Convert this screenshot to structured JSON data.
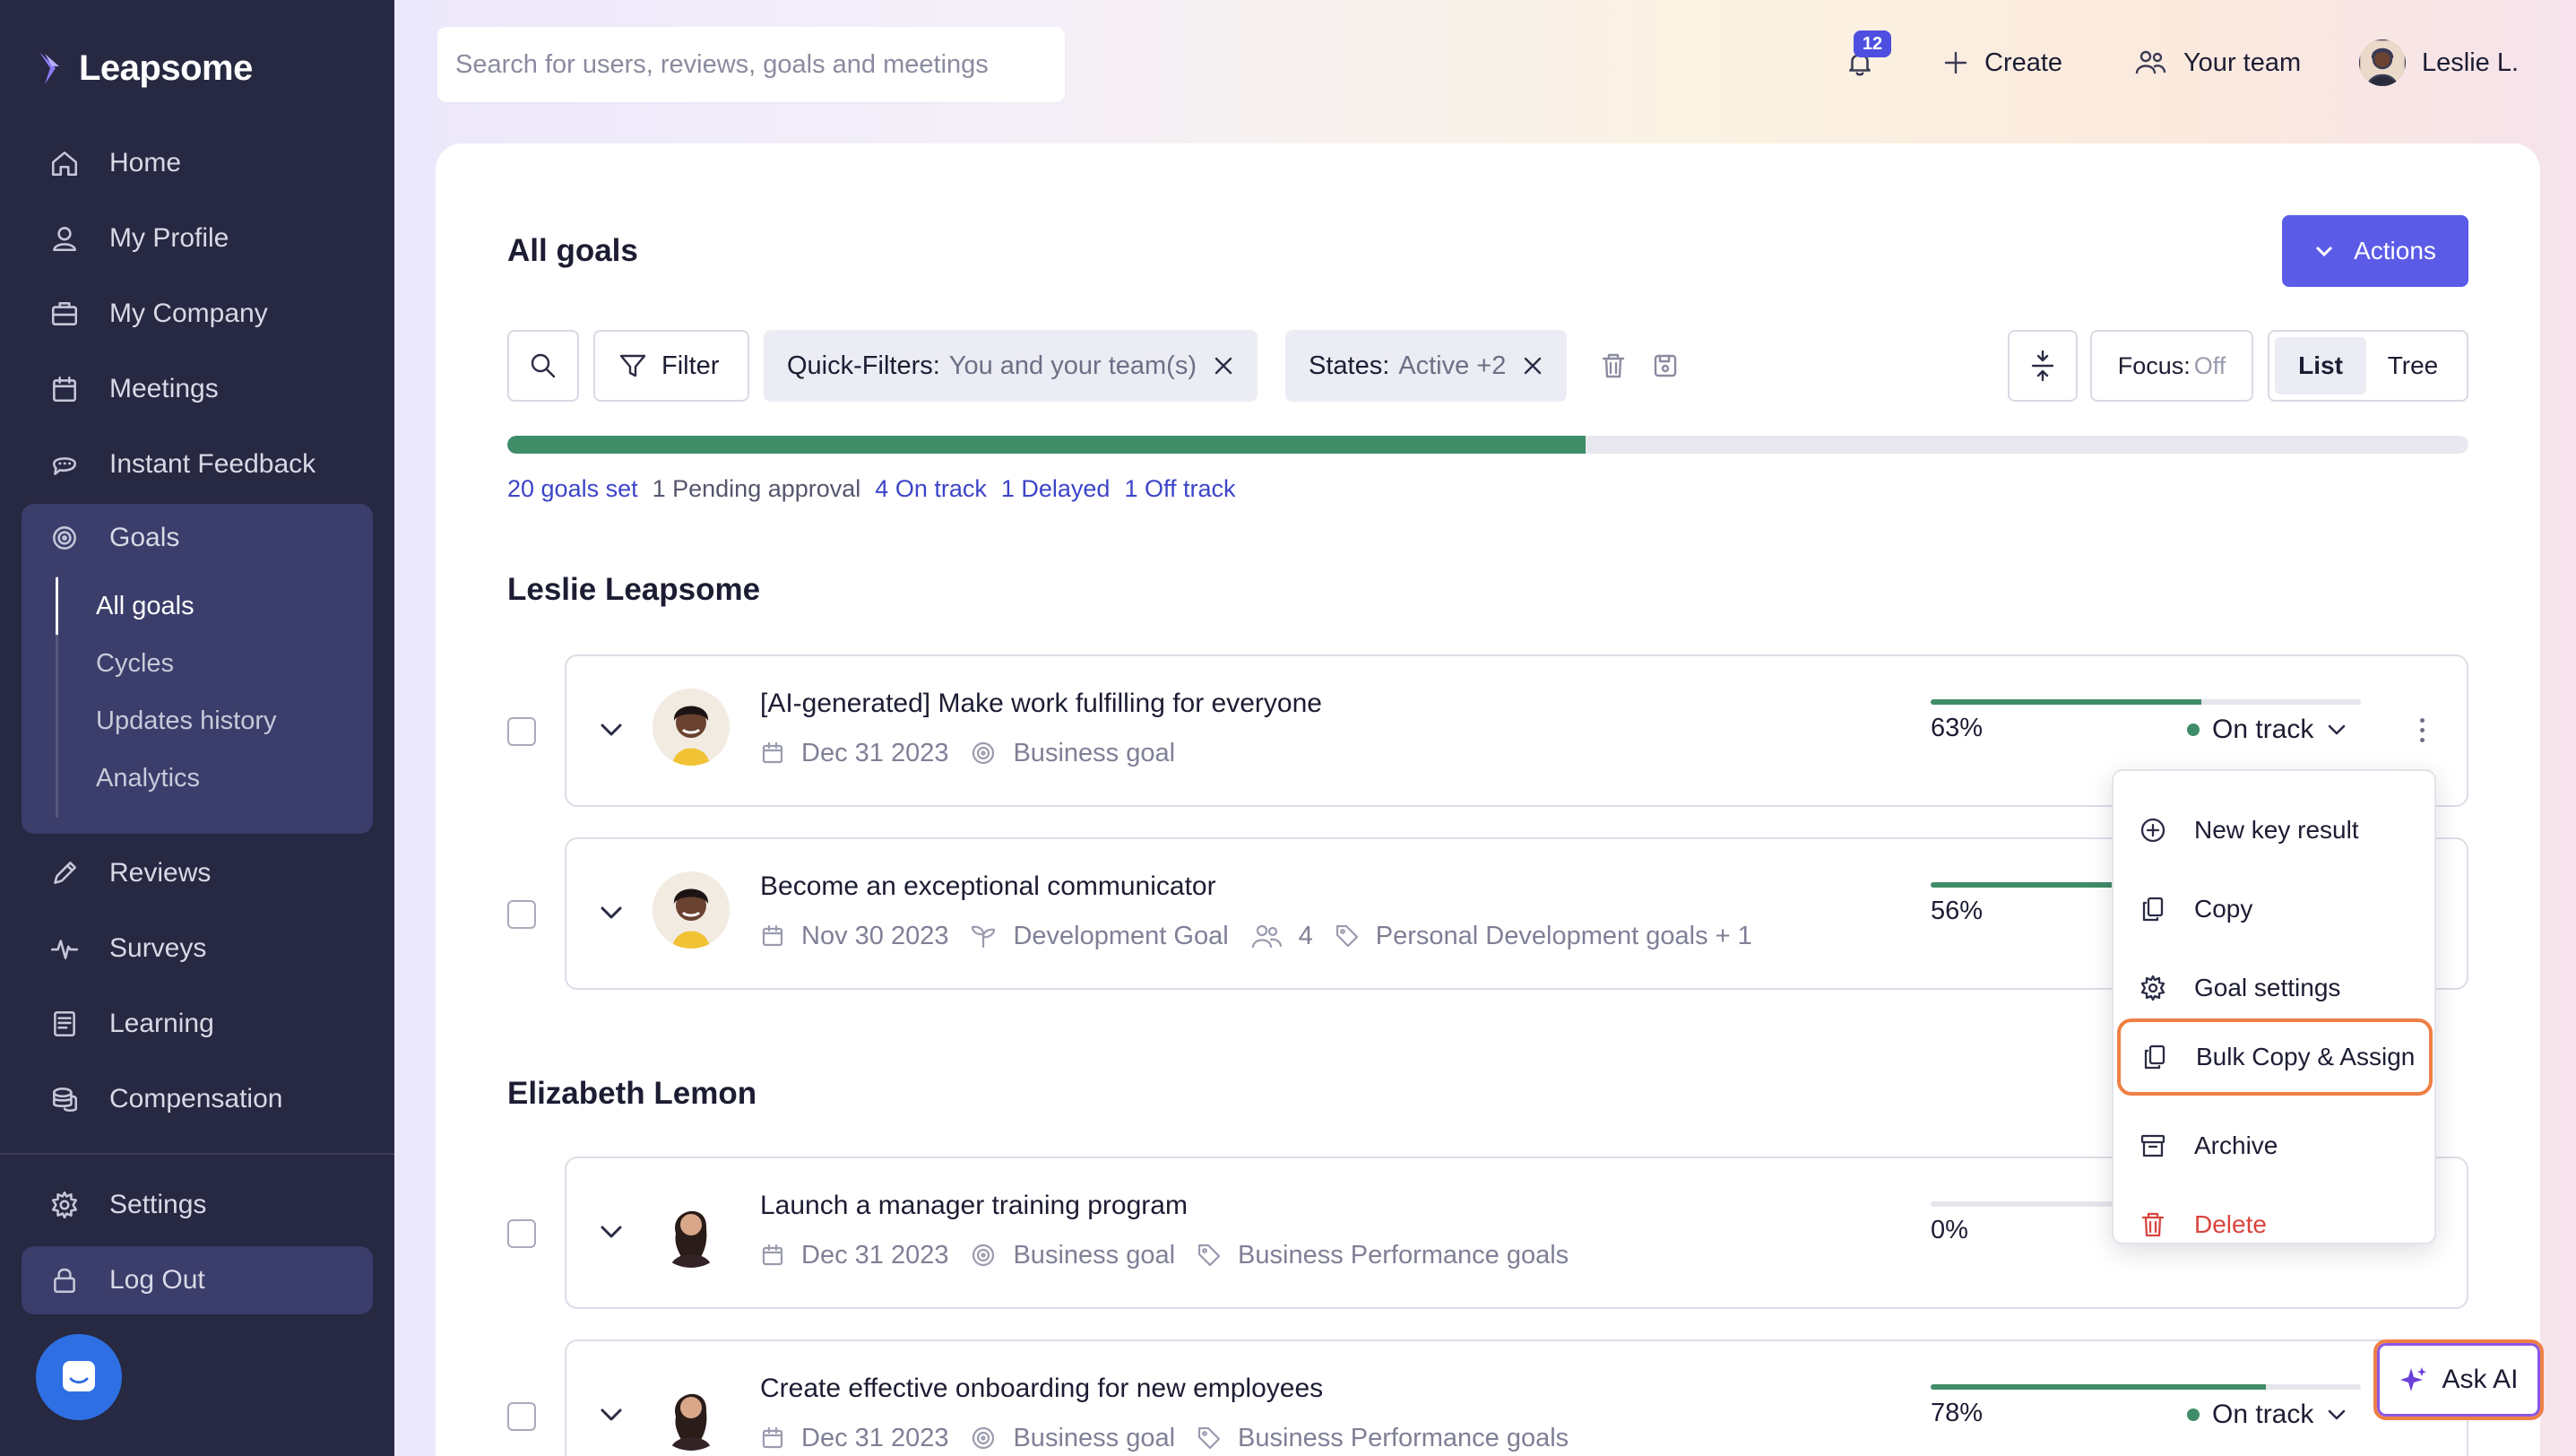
{
  "app": {
    "brand": "Leapsome",
    "accent": "#5b5be8",
    "sidebar_bg": "#272841",
    "success_color": "#3f8c68",
    "highlight_color": "#ef7f45"
  },
  "sidebar": {
    "items": [
      {
        "label": "Home",
        "icon": "home-icon"
      },
      {
        "label": "My Profile",
        "icon": "user-icon"
      },
      {
        "label": "My Company",
        "icon": "briefcase-icon"
      },
      {
        "label": "Meetings",
        "icon": "calendar-icon"
      },
      {
        "label": "Instant Feedback",
        "icon": "chat-bubble-icon"
      },
      {
        "label": "Goals",
        "icon": "target-icon"
      },
      {
        "label": "Reviews",
        "icon": "pencil-icon"
      },
      {
        "label": "Surveys",
        "icon": "pulse-icon"
      },
      {
        "label": "Learning",
        "icon": "book-icon"
      },
      {
        "label": "Compensation",
        "icon": "coins-icon"
      },
      {
        "label": "Settings",
        "icon": "gear-icon"
      },
      {
        "label": "Log Out",
        "icon": "lock-icon"
      }
    ],
    "goals_sub": [
      "All goals",
      "Cycles",
      "Updates history",
      "Analytics"
    ],
    "active_sub": "All goals"
  },
  "topbar": {
    "search_placeholder": "Search for users, reviews, goals and meetings",
    "notifications_count": "12",
    "create_label": "Create",
    "team_label": "Your team",
    "user_label": "Leslie L."
  },
  "main": {
    "title": "All goals",
    "actions_label": "Actions",
    "filter_label": "Filter",
    "quick_filter_key": "Quick-Filters:",
    "quick_filter_value": "You and your team(s)",
    "states_key": "States:",
    "states_value": "Active +2",
    "focus_key": "Focus:",
    "focus_value": "Off",
    "view_list": "List",
    "view_tree": "Tree",
    "overall_progress": 0.55,
    "stats": {
      "goals_set": "20 goals set",
      "pending": "1 Pending approval",
      "on_track": "4 On track",
      "delayed": "1 Delayed",
      "off_track": "1 Off track"
    }
  },
  "groups": [
    {
      "owner": "Leslie Leapsome",
      "goals": [
        {
          "title": "[AI-generated] Make work fulfilling for everyone",
          "date": "Dec 31 2023",
          "type": "Business goal",
          "progress": 0.63,
          "pct": "63%",
          "status": "On track"
        },
        {
          "title": "Become an exceptional communicator",
          "date": "Nov 30 2023",
          "type": "Development Goal",
          "participants": "4",
          "tags": "Personal Development goals + 1",
          "progress": 0.56,
          "pct": "56%"
        }
      ]
    },
    {
      "owner": "Elizabeth Lemon",
      "goals": [
        {
          "title": "Launch a manager training program",
          "date": "Dec 31 2023",
          "type": "Business goal",
          "tags": "Business Performance goals",
          "progress": 0.0,
          "pct": "0%"
        },
        {
          "title": "Create effective onboarding for new employees",
          "date": "Dec 31 2023",
          "type": "Business goal",
          "tags": "Business Performance goals",
          "progress": 0.78,
          "pct": "78%",
          "status": "On track"
        }
      ]
    }
  ],
  "context_menu": {
    "items": [
      "New key result",
      "Copy",
      "Goal settings",
      "Bulk Copy & Assign",
      "Archive",
      "Delete"
    ]
  },
  "ask_ai_label": "Ask AI"
}
